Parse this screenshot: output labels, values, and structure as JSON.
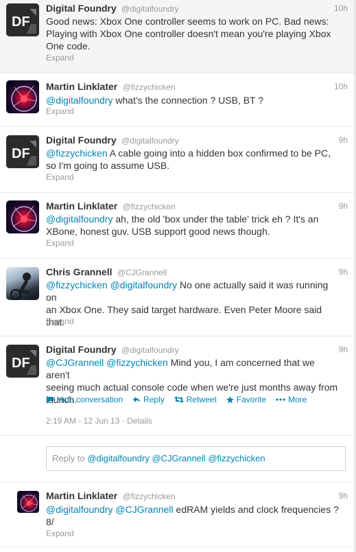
{
  "colors": {
    "link": "#0084b4",
    "muted": "#999999",
    "text": "#333333"
  },
  "tweets": [
    {
      "name": "Digital Foundry",
      "handle": "@digitalfoundry",
      "time": "10h",
      "text": "Good news: Xbox One controller seems to work on PC. Bad news: Playing with Xbox One controller doesn't mean you're playing Xbox One code.",
      "lines": [
        "Good news: Xbox One controller seems to work on PC. Bad news:",
        "Playing with Xbox One controller doesn't mean you're playing Xbox",
        "One code."
      ],
      "expand": "Expand",
      "avatar": "digital-foundry-logo"
    },
    {
      "name": "Martin Linklater",
      "handle": "@fizzychicken",
      "time": "10h",
      "mentions": "@digitalfoundry",
      "text": " what's the connection ? USB, BT ?",
      "expand": "Expand",
      "avatar": "plasma-ball"
    },
    {
      "name": "Digital Foundry",
      "handle": "@digitalfoundry",
      "time": "9h",
      "mentions": "@fizzychicken",
      "line1": " A cable going into a hidden box confirmed to be PC,",
      "line2": "so I'm going to assume USB.",
      "expand": "Expand",
      "avatar": "digital-foundry-logo"
    },
    {
      "name": "Martin Linklater",
      "handle": "@fizzychicken",
      "time": "9h",
      "mentions": "@digitalfoundry",
      "line1": " ah, the old 'box under the table' trick eh ? It's an",
      "line2": "XBone, honest guv. USB support good news though.",
      "expand": "Expand",
      "avatar": "plasma-ball"
    },
    {
      "name": "Chris Grannell",
      "handle": "@CJGrannell",
      "time": "9h",
      "mention1": "@fizzychicken",
      "mention2": "@digitalfoundry",
      "line1": " No one actually said it was running on",
      "line2": "an Xbox One. They said target hardware. Even Peter Moore said",
      "line3": "that.",
      "expand": "Expand",
      "avatar": "cyclist-photo"
    },
    {
      "name": "Digital Foundry",
      "handle": "@digitalfoundry",
      "time": "9h",
      "mention1": "@CJGrannell",
      "mention2": "@fizzychicken",
      "line1": " Mind you, I am concerned that we aren't",
      "line2": "seeing much actual console code when we're just months away from",
      "line3": "launch.",
      "avatar": "digital-foundry-logo",
      "actions": {
        "hide": "Hide conversation",
        "reply": "Reply",
        "retweet": "Retweet",
        "favorite": "Favorite",
        "more": "More"
      },
      "timestamp": "2:19 AM - 12 Jun 13",
      "details": "Details"
    },
    {
      "name": "Martin Linklater",
      "handle": "@fizzychicken",
      "time": "9h",
      "mention1": "@digitalfoundry",
      "mention2": "@CJGrannell",
      "line1": " edRAM yields and clock frequencies ?",
      "line2": "8/",
      "expand": "Expand",
      "avatar": "plasma-ball"
    }
  ],
  "reply_box": {
    "prefix": "Reply to ",
    "m1": "@digitalfoundry",
    "m2": "@CJGrannell",
    "m3": "@fizzychicken"
  }
}
